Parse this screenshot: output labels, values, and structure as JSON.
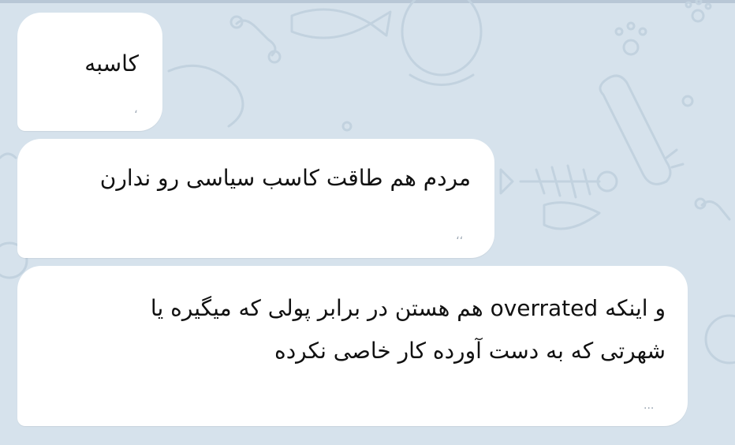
{
  "messages": [
    {
      "text_lines": [
        "کاسبه"
      ],
      "time": "،"
    },
    {
      "text_lines": [
        "مردم هم طاقت کاسب سیاسی رو ندارن"
      ],
      "time": "،،"
    },
    {
      "text_lines": [
        {
          "before": "و اینکه ",
          "latin": "overrated",
          "after": " هم هستن در برابر پولی که میگیره یا"
        },
        "شهرتی که به دست آورده کار خاصی نکرده"
      ],
      "time": "..."
    }
  ],
  "theme": {
    "chat_background": "#d6e2ec",
    "bubble_color": "#ffffff",
    "text_color": "#111111",
    "doodle_color": "#c2d2df"
  },
  "icons": [
    "fish-bone-icon",
    "paw-icon",
    "bone-icon",
    "scroll-icon",
    "fish-icon",
    "ring-icon"
  ]
}
